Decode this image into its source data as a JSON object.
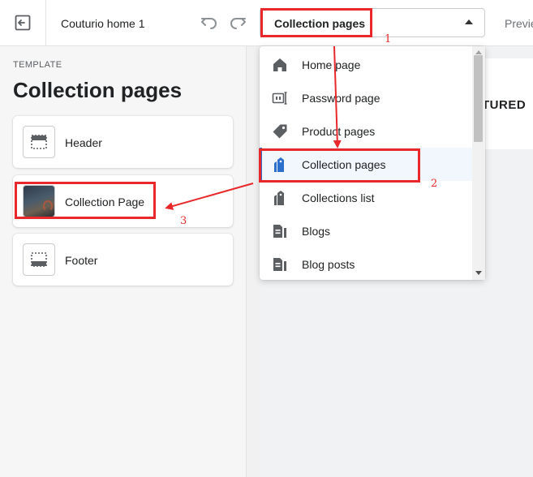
{
  "topbar": {
    "theme_name": "Couturio home 1",
    "page_select_value": "Collection pages",
    "preview_label": "Preview"
  },
  "sidebar": {
    "caption": "TEMPLATE",
    "title": "Collection pages",
    "sections": [
      {
        "label": "Header",
        "icon": "header-section-icon"
      },
      {
        "label": "Collection Page",
        "icon": "collection-image-thumbnail"
      },
      {
        "label": "Footer",
        "icon": "footer-section-icon"
      }
    ]
  },
  "page_menu": {
    "items": [
      {
        "label": "Home page",
        "icon": "home-icon"
      },
      {
        "label": "Password page",
        "icon": "password-icon"
      },
      {
        "label": "Product pages",
        "icon": "tag-icon"
      },
      {
        "label": "Collection pages",
        "icon": "collection-icon",
        "selected": true
      },
      {
        "label": "Collections list",
        "icon": "collections-list-icon"
      },
      {
        "label": "Blogs",
        "icon": "blog-icon"
      },
      {
        "label": "Blog posts",
        "icon": "blog-post-icon"
      }
    ]
  },
  "canvas": {
    "partial_text": "TURED"
  },
  "annotations": {
    "color": "#e8282a",
    "steps": [
      "1",
      "2",
      "3"
    ]
  },
  "colors": {
    "accent": "#2c6ecb",
    "annotation_red": "#e8282a"
  }
}
